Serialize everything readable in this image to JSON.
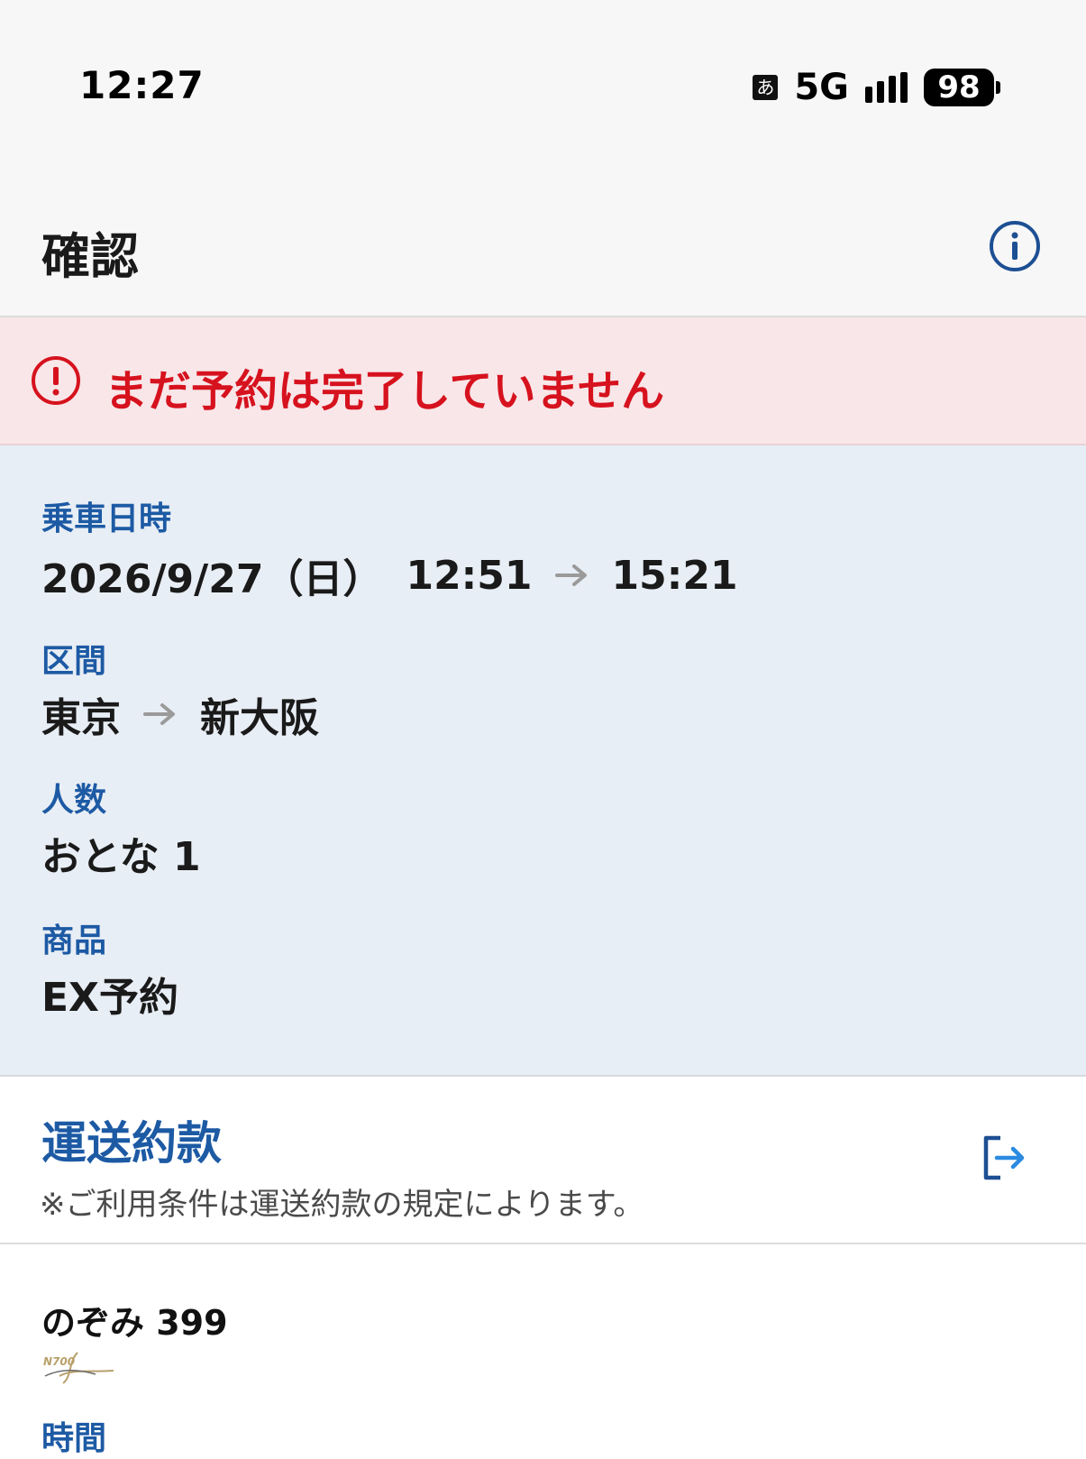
{
  "status_bar": {
    "time": "12:27",
    "ime_glyph": "あ",
    "network": "5G",
    "battery": "98"
  },
  "header": {
    "title": "確認",
    "info_icon": "info-circle-icon"
  },
  "alert": {
    "icon": "exclamation-circle-icon",
    "message": "まだ予約は完了していません",
    "color": "#d6121e",
    "background": "#f8e6e8"
  },
  "summary": {
    "boarding": {
      "label": "乗車日時",
      "date": "2026/9/27（日）",
      "depart": "12:51",
      "arrive": "15:21"
    },
    "section": {
      "label": "区間",
      "from": "東京",
      "to": "新大阪"
    },
    "passengers": {
      "label": "人数",
      "value": "おとな 1"
    },
    "product": {
      "label": "商品",
      "value": "EX予約"
    }
  },
  "terms": {
    "title": "運送約款",
    "note": "※ご利用条件は運送約款の規定によります。",
    "icon": "external-link-icon"
  },
  "train": {
    "name": "のぞみ 399",
    "logo_icon": "n700s-logo-icon",
    "time_label": "時間"
  },
  "colors": {
    "accent_blue": "#1d5aa4",
    "summary_background": "#e8eef5",
    "alert_red": "#d6121e"
  }
}
